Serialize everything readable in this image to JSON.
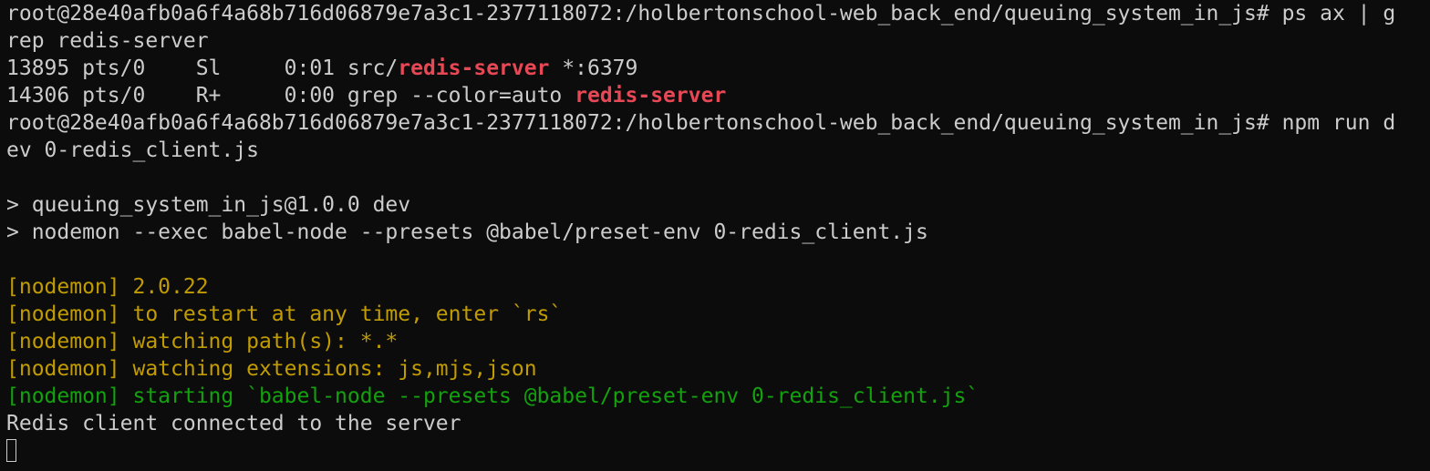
{
  "terminal": {
    "prompt": "root@28e40afb0a6f4a68b716d06879e7a3c1-2377118072:/holbertonschool-web_back_end/queuing_system_in_js#",
    "cmd1_part1": " ps ax | g",
    "cmd1_part2": "rep redis-server",
    "proc1_prefix": "13895 pts/0    Sl     0:01 src/",
    "proc1_match": "redis-server",
    "proc1_suffix": " *:6379",
    "proc2_prefix": "14306 pts/0    R+     0:00 grep --color=auto ",
    "proc2_match": "redis-server",
    "cmd2_part1": " npm run d",
    "cmd2_part2": "ev 0-redis_client.js",
    "npm_line1": "> queuing_system_in_js@1.0.0 dev",
    "npm_line2": "> nodemon --exec babel-node --presets @babel/preset-env 0-redis_client.js",
    "nodemon_lines": [
      "[nodemon] 2.0.22",
      "[nodemon] to restart at any time, enter `rs`",
      "[nodemon] watching path(s): *.*",
      "[nodemon] watching extensions: js,mjs,json"
    ],
    "nodemon_start": "[nodemon] starting `babel-node --presets @babel/preset-env 0-redis_client.js`",
    "output": "Redis client connected to the server"
  },
  "colors": {
    "background": "#0c0c0c",
    "foreground": "#cccccc",
    "match_red": "#e74856",
    "nodemon_yellow": "#c19c00",
    "nodemon_green": "#13a10e"
  }
}
